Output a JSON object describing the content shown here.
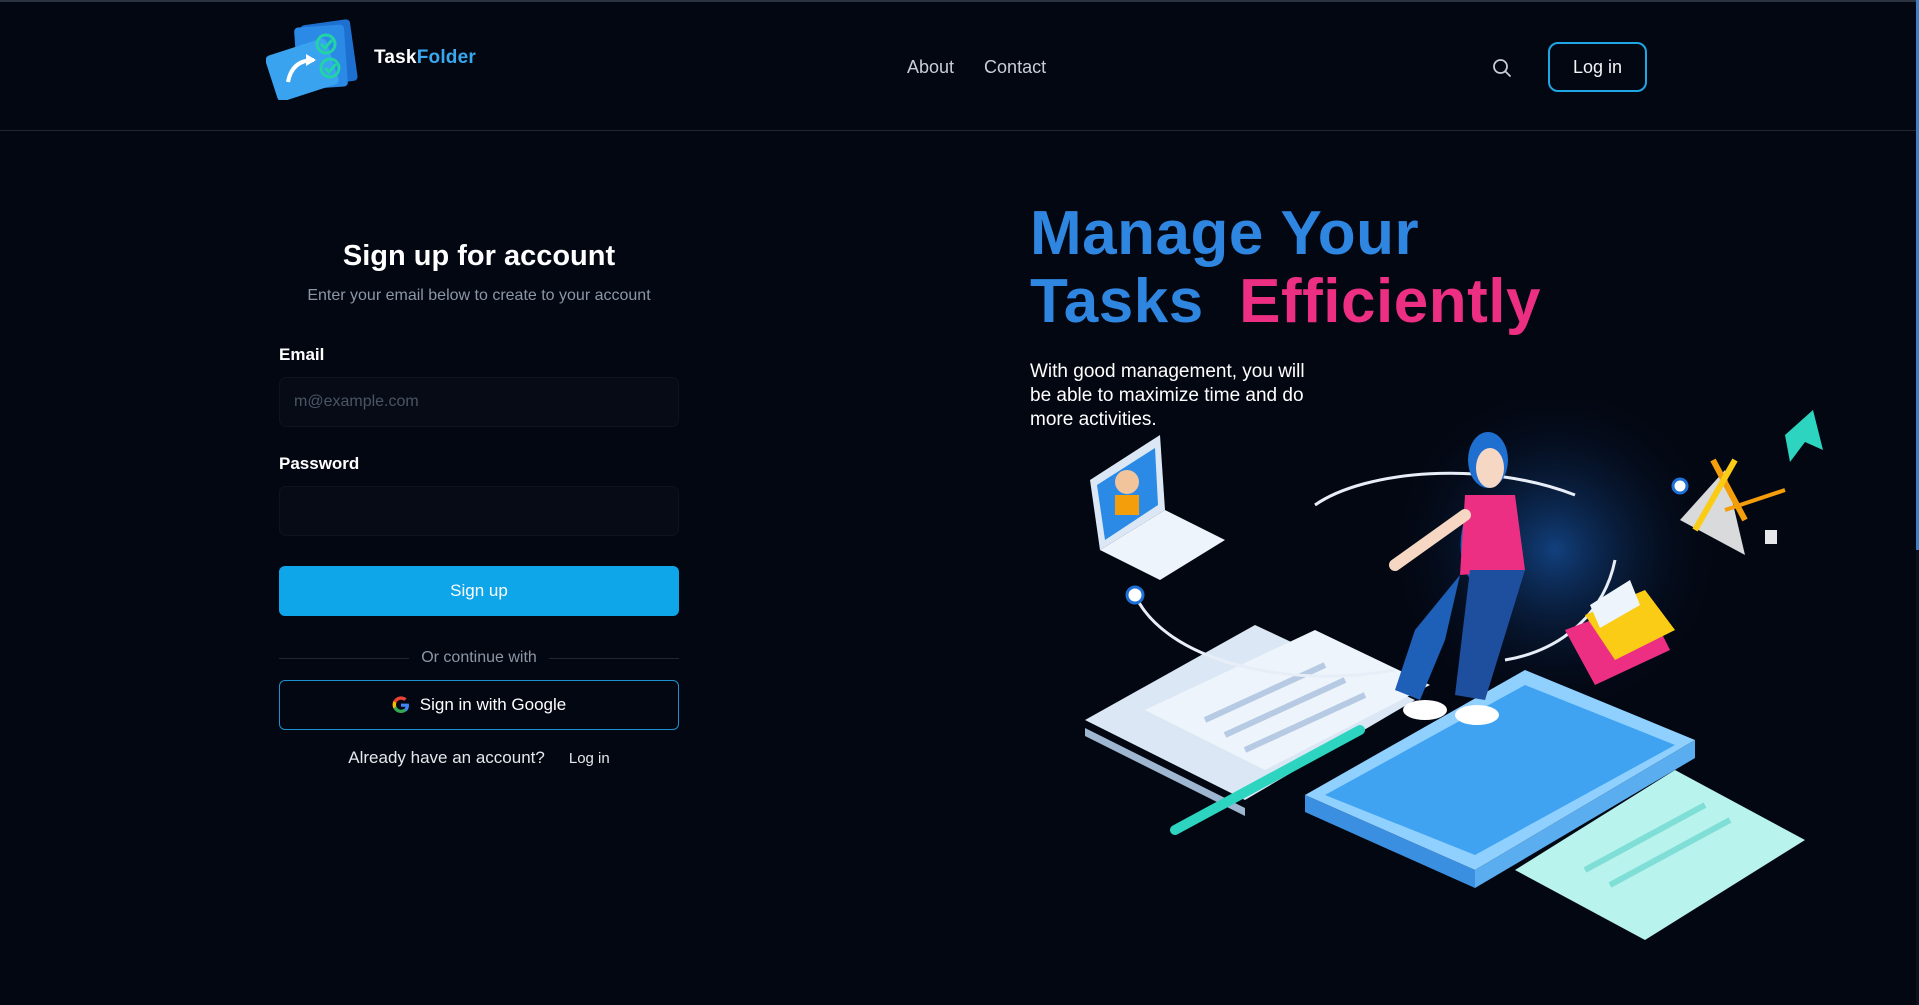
{
  "header": {
    "logo": {
      "part1": "Task",
      "part2": "Folder"
    },
    "nav": [
      {
        "label": "About"
      },
      {
        "label": "Contact"
      }
    ],
    "search_icon": "search-icon",
    "login_label": "Log in"
  },
  "form": {
    "title": "Sign up for account",
    "subtitle": "Enter your email below to create to your account",
    "email_label": "Email",
    "email_placeholder": "m@example.com",
    "email_value": "",
    "password_label": "Password",
    "password_value": "",
    "submit_label": "Sign up",
    "divider_text": "Or continue with",
    "google_label": "Sign in with Google",
    "footer_question": "Already have an account?",
    "footer_link": "Log in"
  },
  "hero": {
    "line1a": "Manage",
    "line1b": "Your",
    "line2a": "Tasks",
    "line2b": "Efficiently",
    "tagline": "With good management, you will be able to maximize time and do more activities."
  },
  "colors": {
    "background": "#030712",
    "accent_blue": "#0ea5e9",
    "headline_blue": "#2f86e0",
    "headline_pink": "#ec2f82"
  }
}
